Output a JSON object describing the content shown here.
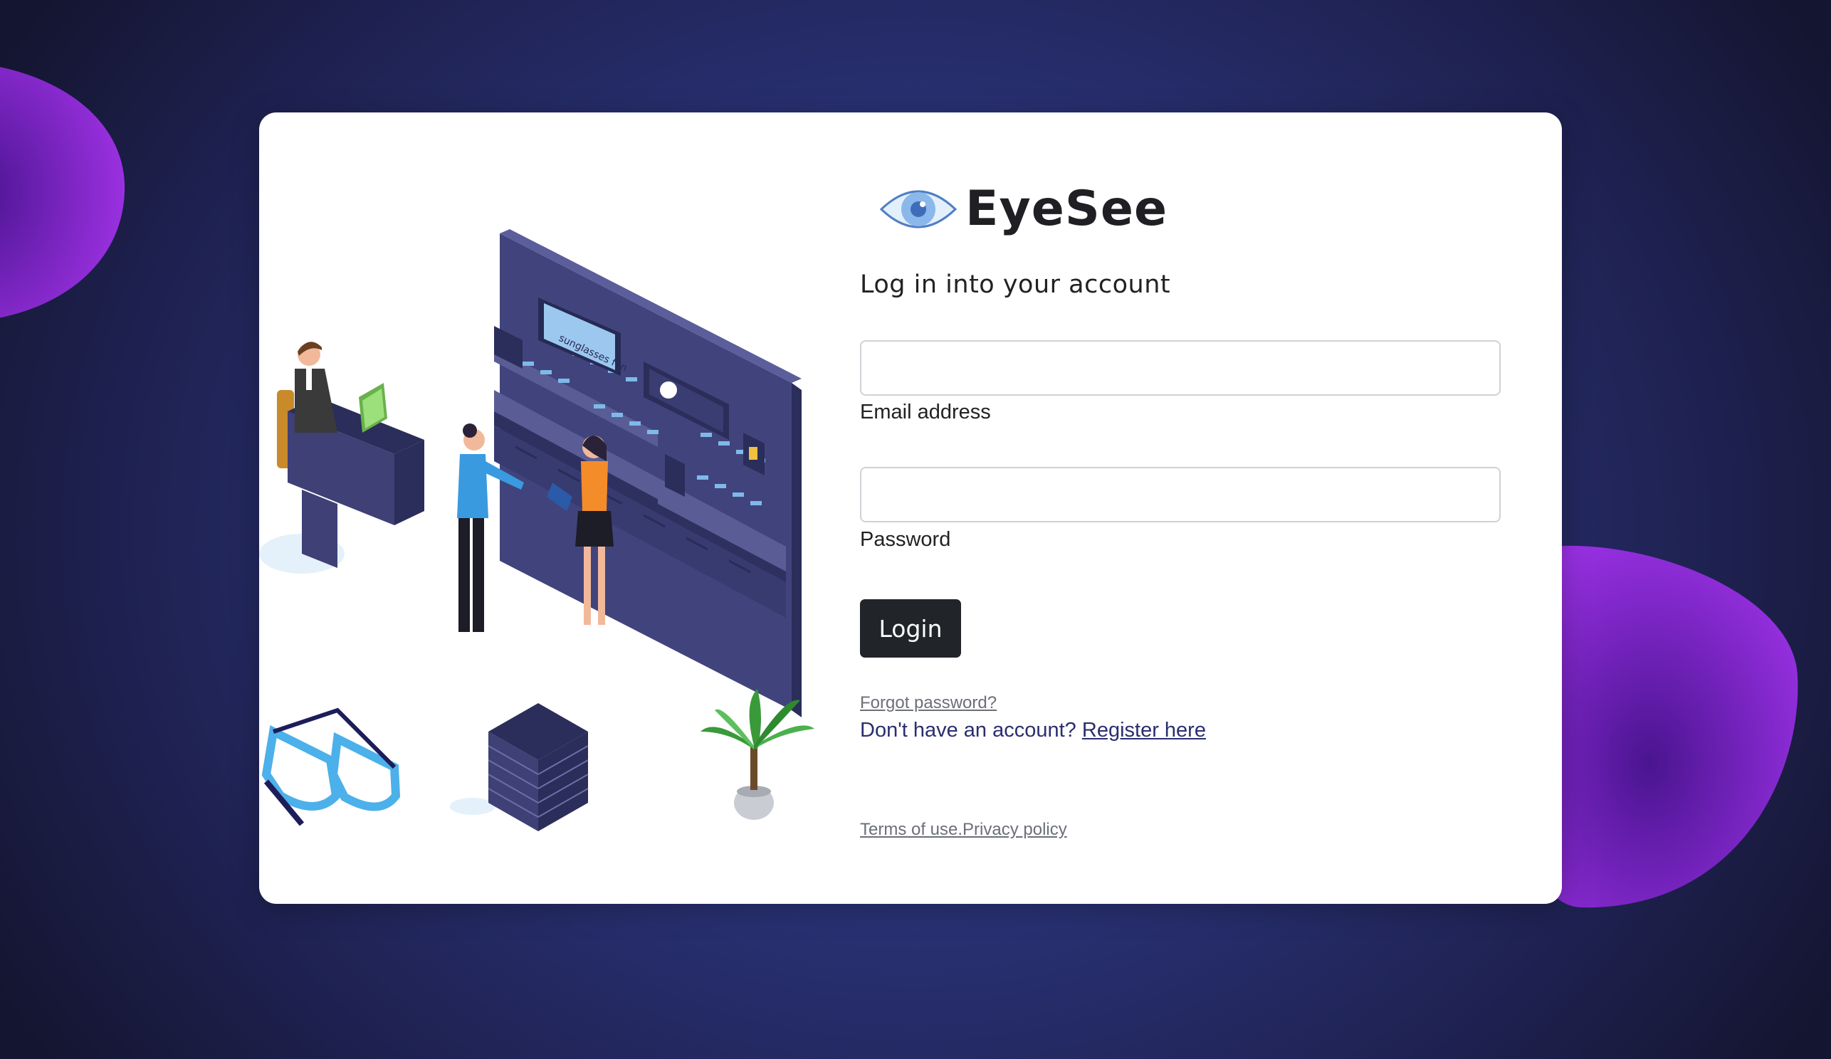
{
  "brand": {
    "name": "EyeSee",
    "logo_icon": "eye-icon",
    "accent_color": "#5b8fd6"
  },
  "login": {
    "heading": "Log in into your account",
    "email_label": "Email address",
    "email_value": "",
    "password_label": "Password",
    "password_value": "",
    "login_button": "Login",
    "forgot_link": "Forgot password?",
    "register_prompt": "Don't have an account?",
    "register_link": "Register here",
    "terms_link": "Terms of use.",
    "privacy_link": "Privacy policy"
  },
  "illustration": {
    "display_text": "sunglasses fun",
    "icon": "optical-store-illustration"
  },
  "colors": {
    "background": "#2a3276",
    "card": "#ffffff",
    "button": "#212428",
    "blob": "#8a2be2",
    "link": "#2a2e6e"
  }
}
